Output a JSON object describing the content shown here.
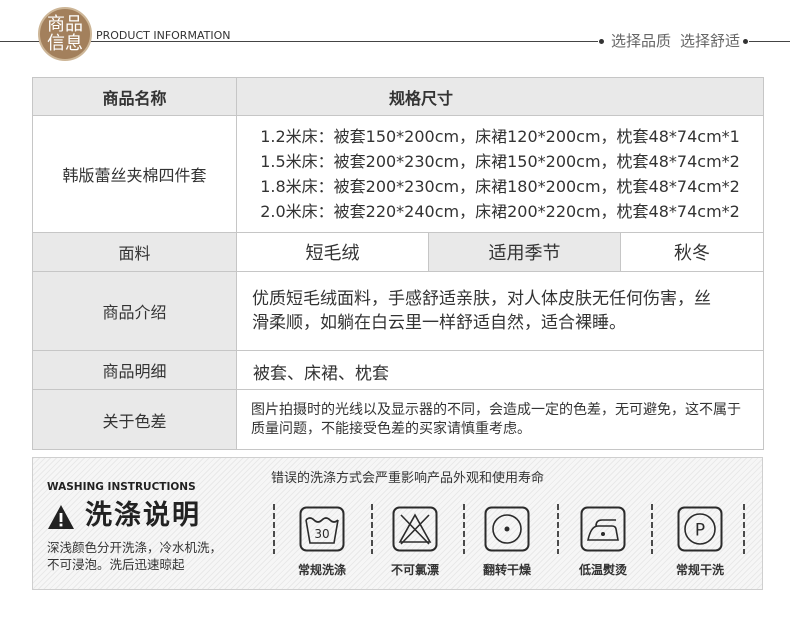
{
  "colors": {
    "badge": "#a3805c",
    "label_cell": "#e9e9e9",
    "border": "#c6c6c6",
    "text": "#333333"
  },
  "header": {
    "badge_line1": "商品",
    "badge_line2": "信息",
    "subtitle": "PRODUCT INFORMATION",
    "slogan": [
      "选择品质",
      "选择舒适"
    ]
  },
  "table": {
    "name_header": "商品名称",
    "spec_header": "规格尺寸",
    "product_name": "韩版蕾丝夹棉四件套",
    "sizes": [
      "1.2米床：被套150*200cm，床裙120*200cm，枕套48*74cm*1",
      "1.5米床：被套200*230cm，床裙150*200cm，枕套48*74cm*2",
      "1.8米床：被套200*230cm，床裙180*200cm，枕套48*74cm*2",
      "2.0米床：被套220*240cm，床裙200*220cm，枕套48*74cm*2"
    ],
    "fabric_label": "面料",
    "fabric_value": "短毛绒",
    "season_label": "适用季节",
    "season_value": "秋冬",
    "intro_label": "商品介绍",
    "intro_value": "优质短毛绒面料，手感舒适亲肤，对人体皮肤无任何伤害，丝滑柔顺，如躺在白云里一样舒适自然，适合裸睡。",
    "detail_label": "商品明细",
    "detail_value": "被套、床裙、枕套",
    "color_label": "关于色差",
    "color_value": "图片拍摄时的光线以及显示器的不同，会造成一定的色差，无可避免，这不属于质量问题，不能接受色差的买家请慎重考虑。"
  },
  "washing": {
    "title_en": "WASHING INSTRUCTIONS",
    "title_cn": "洗涤说明",
    "warning_icon": "warning-triangle-icon",
    "note_lines": [
      "深浅颜色分开洗涤，冷水机洗，",
      "不可浸泡。洗后迅速晾起"
    ],
    "caution": "错误的洗涤方式会严重影响产品外观和使用寿命",
    "symbols": [
      {
        "icon": "wash-30-icon",
        "mark": "30",
        "label": "常规洗涤"
      },
      {
        "icon": "no-bleach-icon",
        "label": "不可氯漂"
      },
      {
        "icon": "tumble-dry-icon",
        "label": "翻转干燥"
      },
      {
        "icon": "iron-low-temp-icon",
        "label": "低温熨烫"
      },
      {
        "icon": "dry-clean-icon",
        "mark": "P",
        "label": "常规干洗"
      }
    ]
  }
}
